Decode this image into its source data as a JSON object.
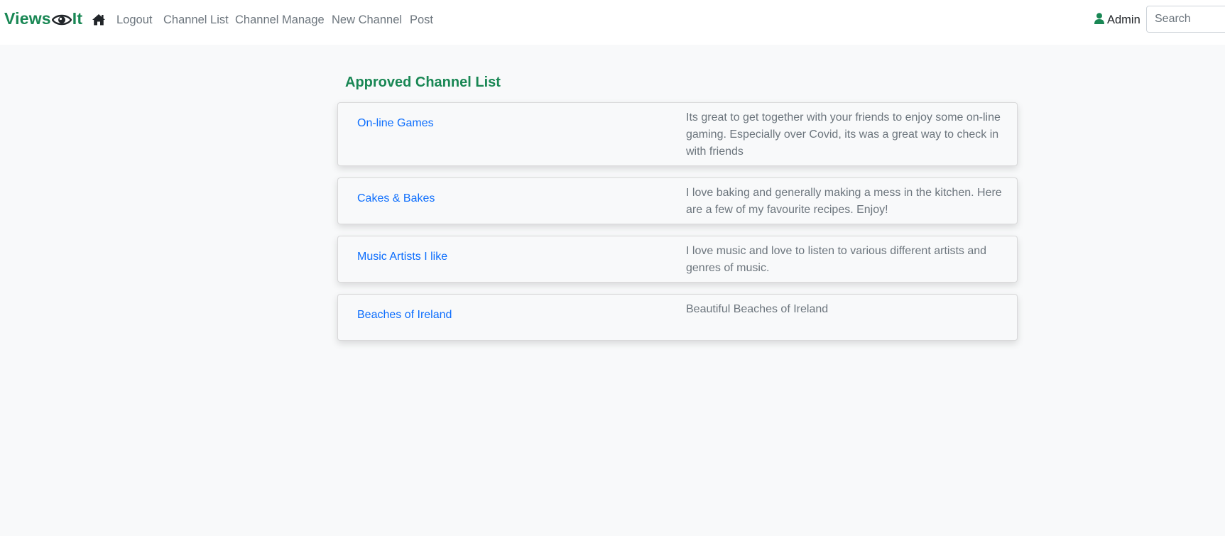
{
  "brand": {
    "left_text": "Views",
    "right_text": "It",
    "icon": "eye-icon",
    "color": "#198754"
  },
  "nav": {
    "home_icon": "home-icon",
    "items": [
      {
        "label": "Logout"
      },
      {
        "label": "Channel List"
      },
      {
        "label": "Channel Manage"
      },
      {
        "label": "New Channel"
      },
      {
        "label": "Post"
      }
    ]
  },
  "user": {
    "icon": "user-icon",
    "name": "Admin"
  },
  "search": {
    "placeholder": "Search",
    "value": ""
  },
  "main": {
    "title": "Approved Channel List",
    "channels": [
      {
        "name": "On-line Games",
        "description": "Its great to get together with your friends to enjoy some on-line gaming. Especially over Covid, its was a great way to check in with friends"
      },
      {
        "name": "Cakes & Bakes",
        "description": "I love baking and generally making a mess in the kitchen. Here are a few of my favourite recipes. Enjoy!"
      },
      {
        "name": "Music Artists I like",
        "description": "I love music and love to listen to various different artists and genres of music."
      },
      {
        "name": "Beaches of Ireland",
        "description": "Beautiful Beaches of Ireland"
      }
    ]
  },
  "colors": {
    "accent": "#198754",
    "link": "#0d6efd",
    "muted_text": "#6c757d",
    "background": "#f8f9fa"
  }
}
